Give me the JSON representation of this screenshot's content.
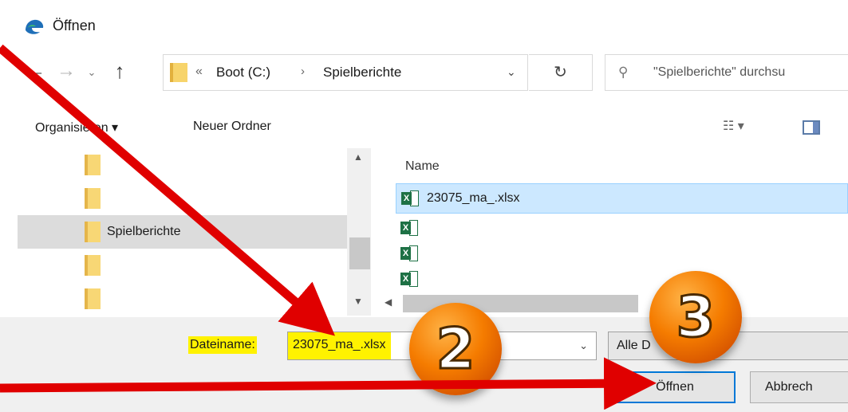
{
  "window": {
    "title": "Öffnen",
    "icon": "edge-app-icon"
  },
  "nav": {
    "back": "←",
    "forward": "→",
    "history": "⌄",
    "up": "↑",
    "path_overflow": "«",
    "path": [
      "Boot (C:)",
      "Spielberichte"
    ],
    "path_separator": "›",
    "dropdown": "⌄",
    "refresh": "↻",
    "search_placeholder": "\"Spielberichte\" durchsu"
  },
  "commands": {
    "organize": "Organisieren ▾",
    "new_folder": "Neuer Ordner",
    "view": "☷ ▾"
  },
  "tree": [
    {
      "label": "",
      "selected": false
    },
    {
      "label": "",
      "selected": false
    },
    {
      "label": "Spielberichte",
      "selected": true
    },
    {
      "label": "",
      "selected": false
    },
    {
      "label": "",
      "selected": false
    }
  ],
  "files": {
    "column_name": "Name",
    "items": [
      {
        "name": "23075_ma_.xlsx",
        "selected": true
      },
      {
        "name": "",
        "selected": false
      },
      {
        "name": "",
        "selected": false
      },
      {
        "name": "",
        "selected": false
      }
    ]
  },
  "bottom": {
    "filename_label": "Dateiname:",
    "filename_value": "23075_ma_.xlsx",
    "filter_value": "Alle D",
    "open_button": "Öffnen",
    "cancel_button": "Abbrech"
  },
  "annotations": {
    "badge_2": "2",
    "badge_3": "3",
    "arrow_color": "#e00000",
    "highlight_color": "#fff200",
    "badge_color": "#f57c00"
  }
}
